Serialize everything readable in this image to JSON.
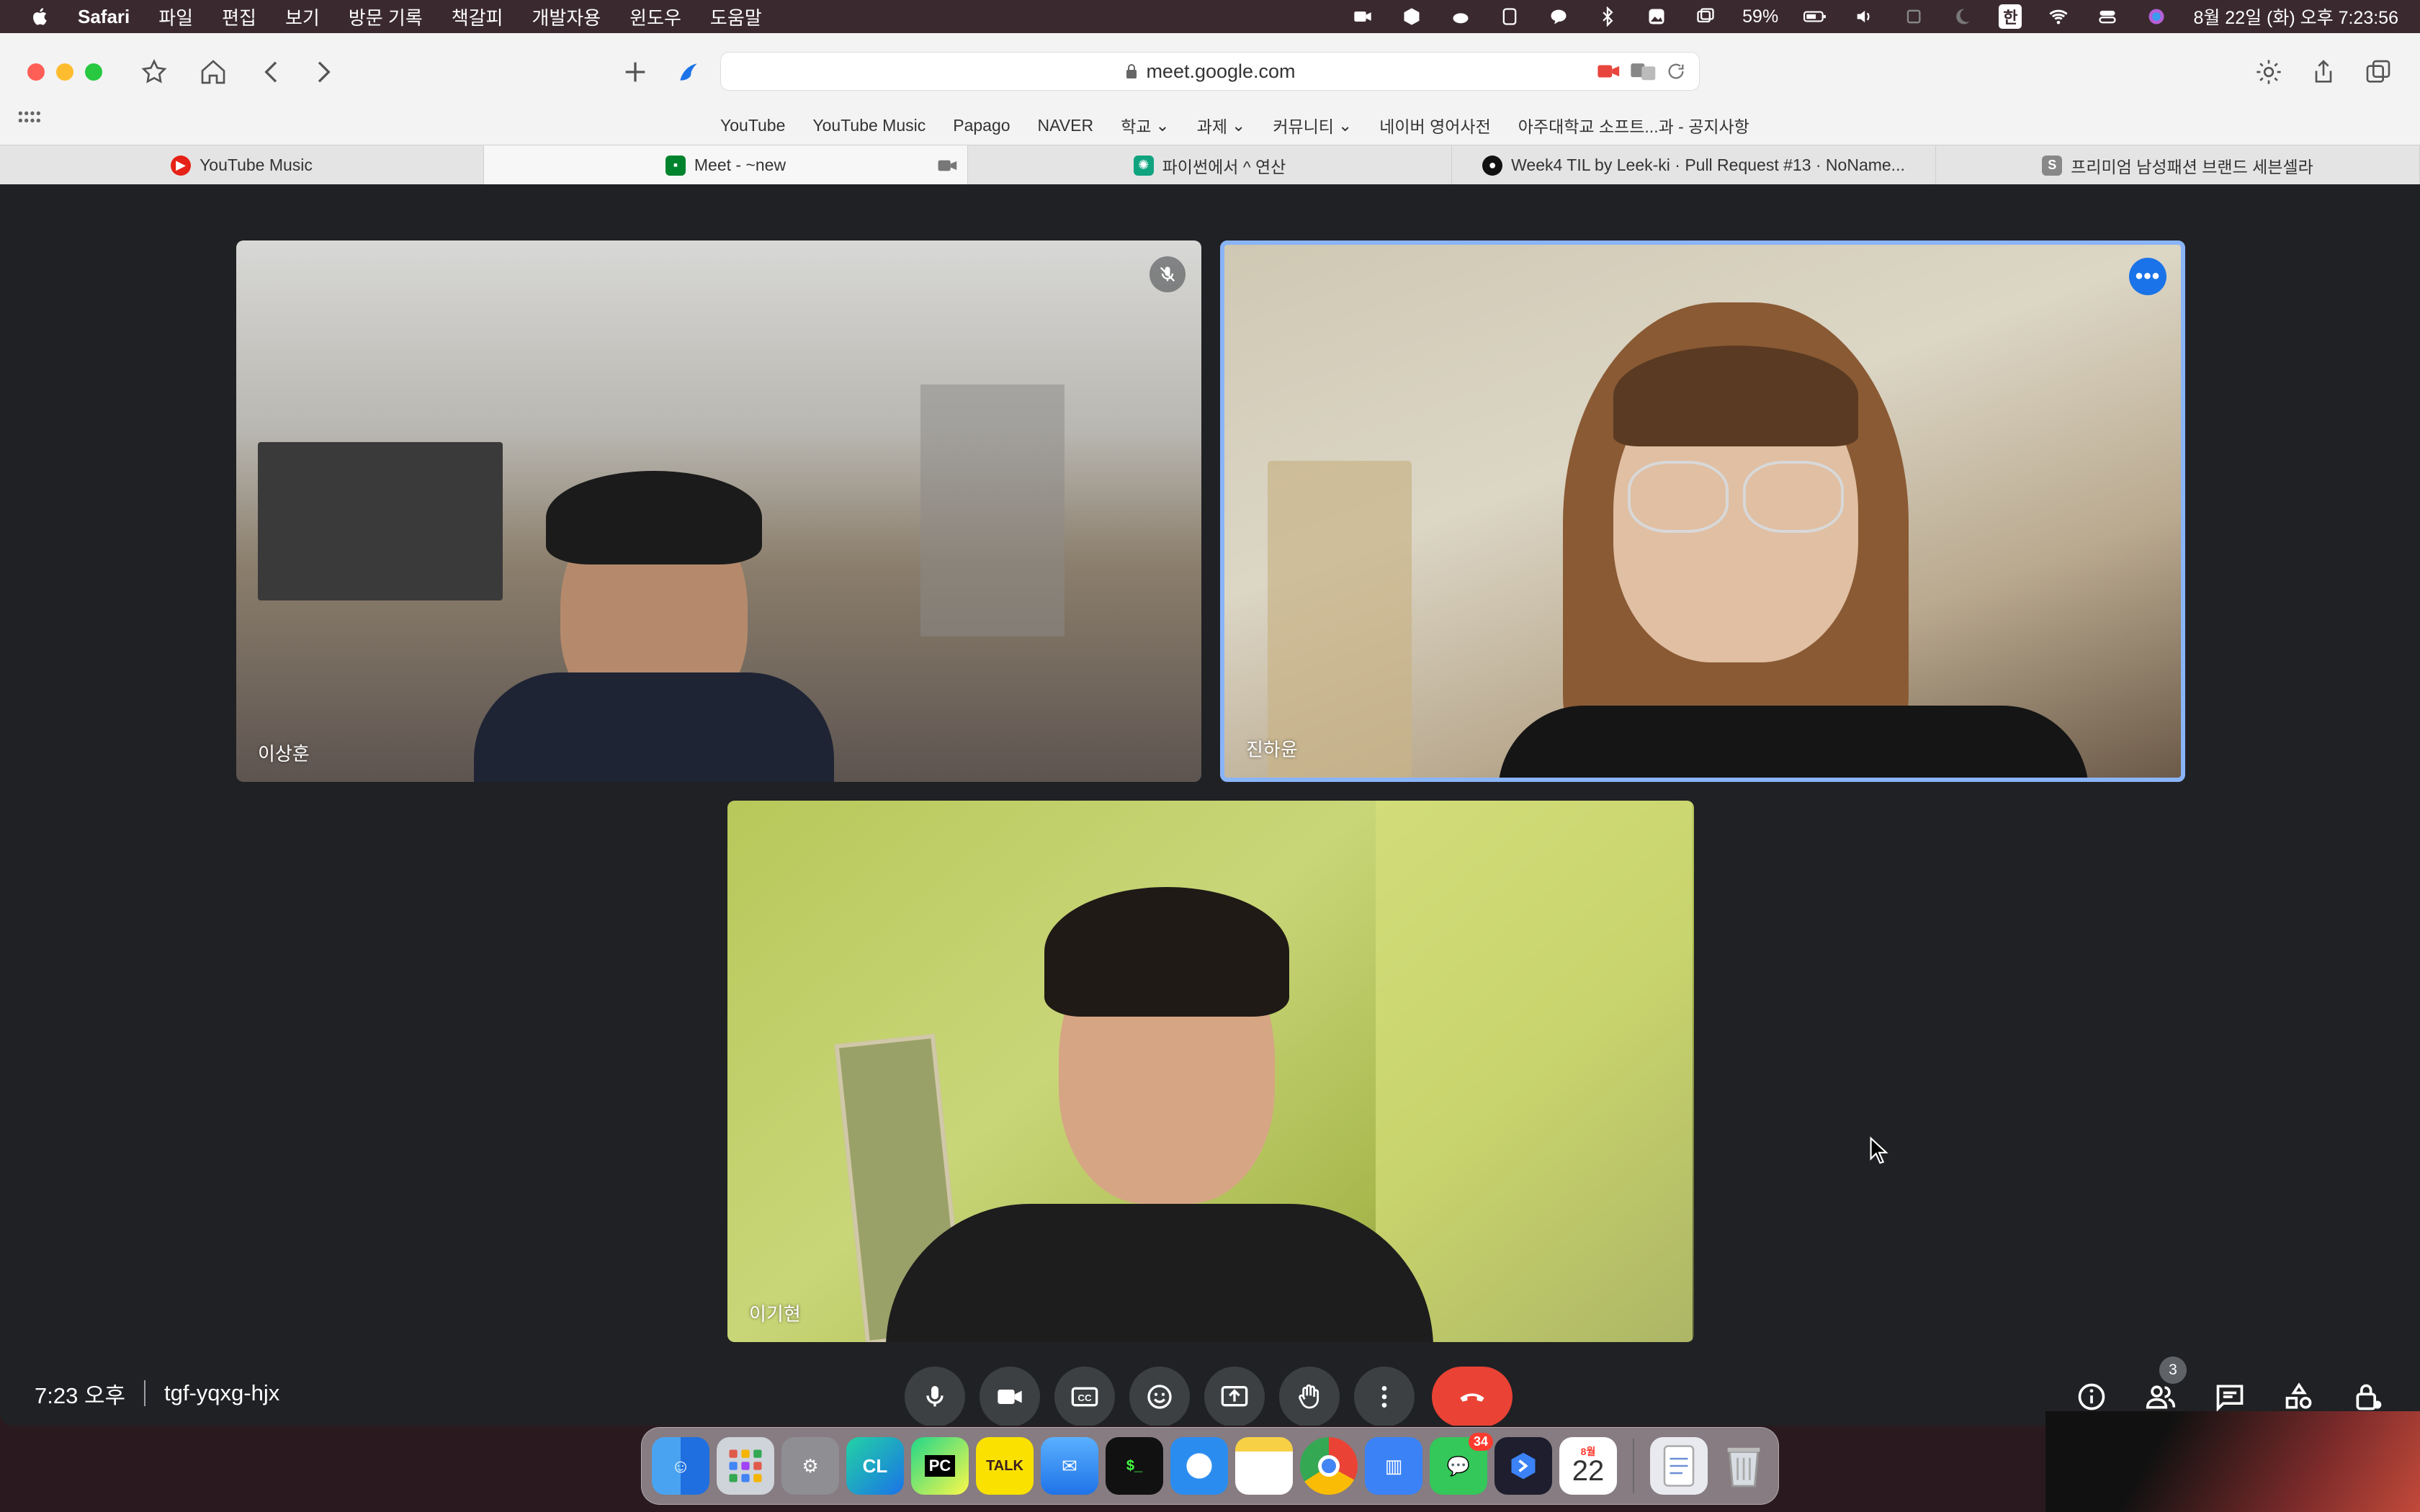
{
  "menubar": {
    "items": [
      "Safari",
      "파일",
      "편집",
      "보기",
      "방문 기록",
      "책갈피",
      "개발자용",
      "윈도우",
      "도움말"
    ],
    "battery": "59%",
    "ime": "한",
    "clock": "8월 22일 (화) 오후 7:23:56"
  },
  "browser": {
    "url": "meet.google.com",
    "bookmarks": [
      "YouTube",
      "YouTube Music",
      "Papago",
      "NAVER",
      "학교",
      "과제",
      "커뮤니티",
      "네이버 영어사전",
      "아주대학교 소프트...과 - 공지사항"
    ],
    "tabs": [
      {
        "label": "YouTube Music",
        "active": false,
        "favicon_color": "#e62117"
      },
      {
        "label": "Meet - ~new",
        "active": true,
        "favicon_color": "#00832d"
      },
      {
        "label": "파이썬에서 ^ 연산",
        "active": false,
        "favicon_color": "#10a37f"
      },
      {
        "label": "Week4 TIL by Leek-ki · Pull Request #13 · NoName...",
        "active": false,
        "favicon_color": "#111111"
      },
      {
        "label": "프리미엄 남성패션 브랜드 세븐셀라",
        "active": false,
        "favicon_color": "#888888"
      }
    ]
  },
  "meet": {
    "participants": [
      {
        "name": "이상훈",
        "muted": true
      },
      {
        "name": "진하윤",
        "speaking": true
      },
      {
        "name": "이기현"
      }
    ],
    "time": "7:23 오후",
    "meeting_code": "tgf-yqxg-hjx",
    "participant_count": "3",
    "accent": "#8ab4f8",
    "end_call_color": "#ea4335"
  },
  "dock": {
    "messages_badge": "34",
    "calendar_month": "8월",
    "calendar_day": "22"
  }
}
